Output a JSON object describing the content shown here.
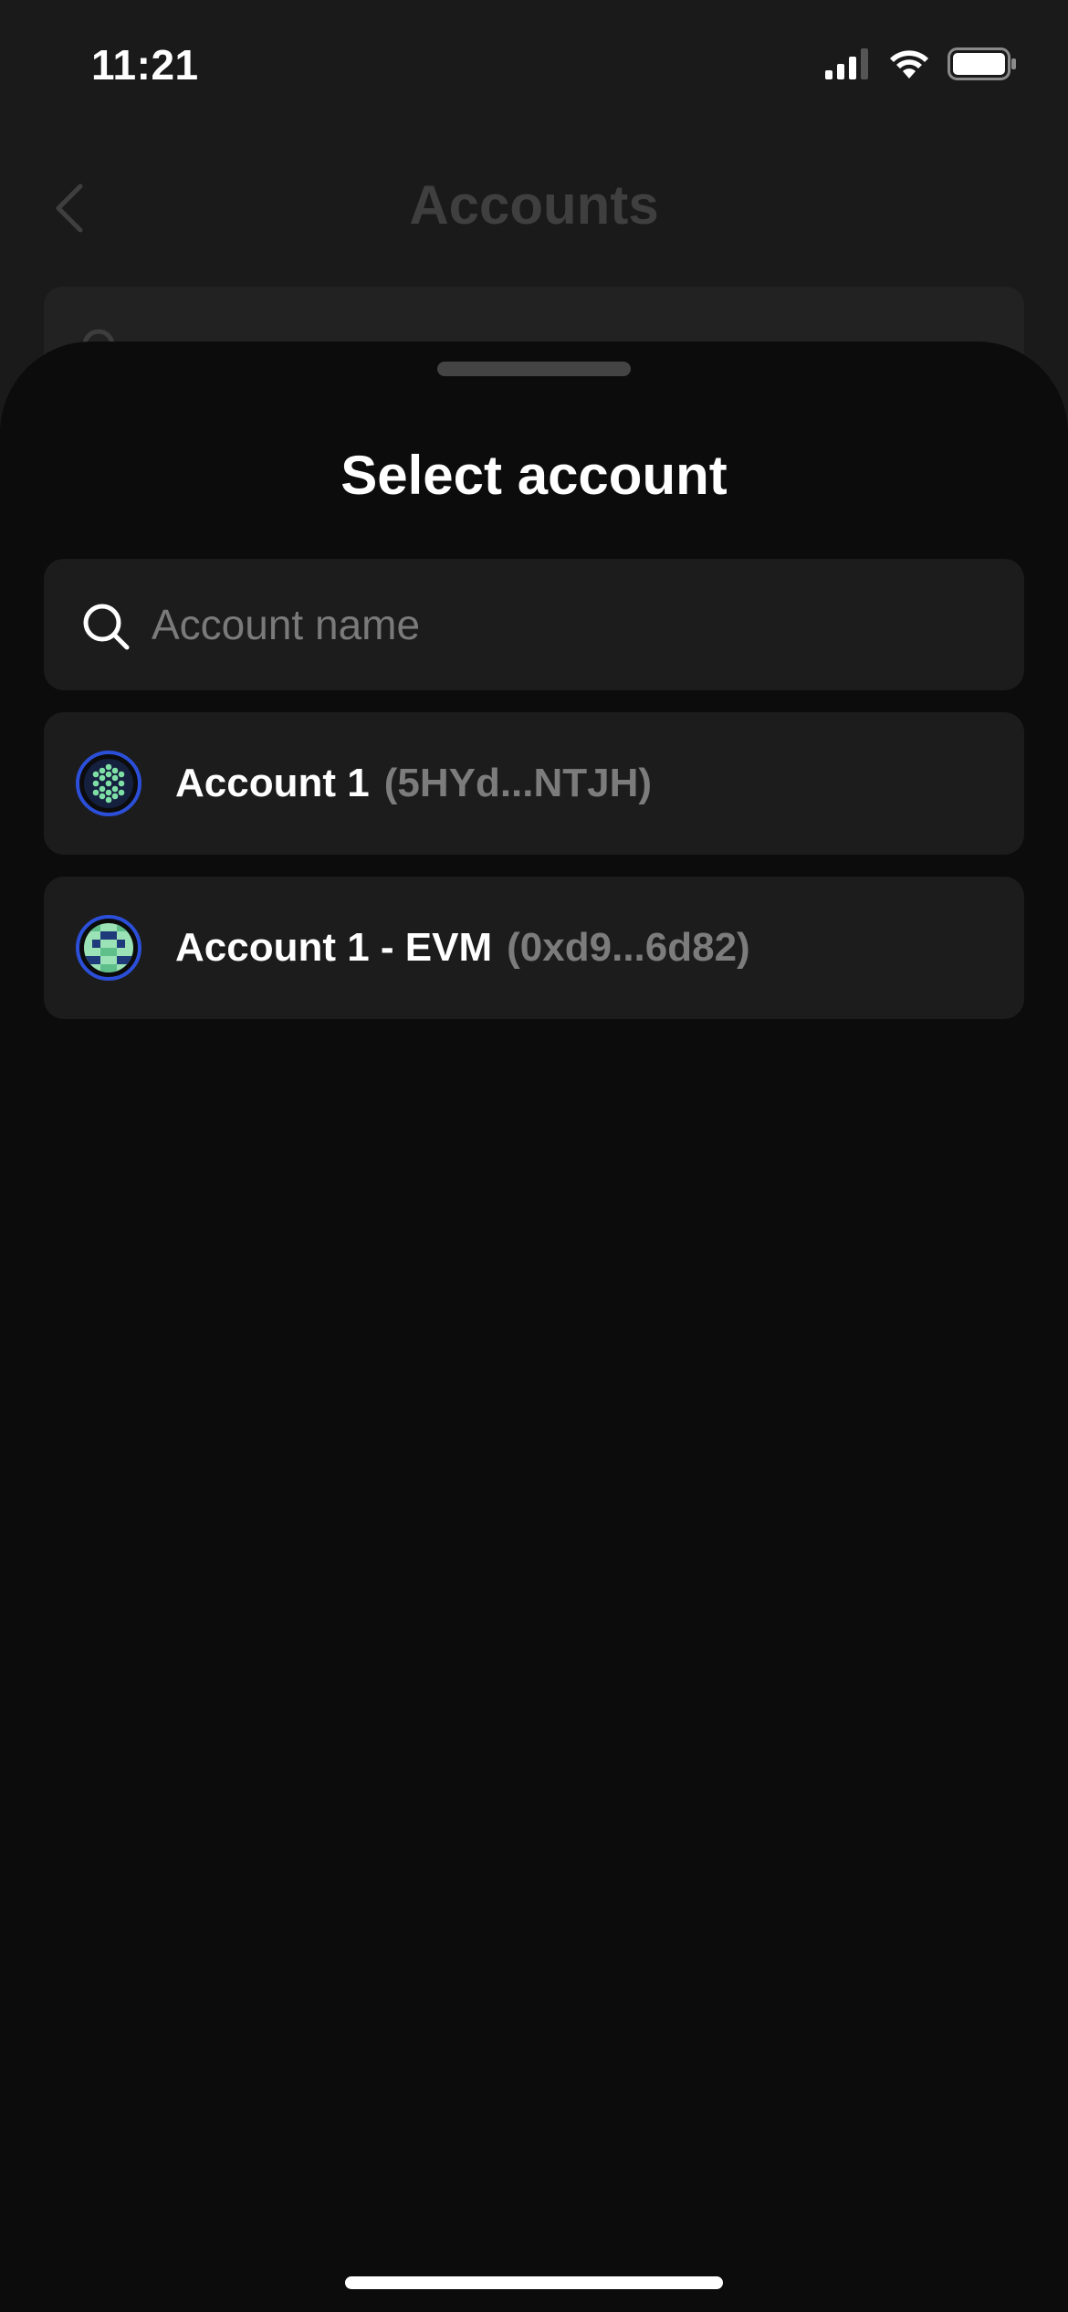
{
  "status_bar": {
    "time": "11:21",
    "icons": [
      "cellular-signal-icon",
      "wifi-icon",
      "battery-icon"
    ]
  },
  "background_page": {
    "title": "Accounts",
    "back_icon": "chevron-left-icon",
    "search_icon": "search-icon"
  },
  "sheet": {
    "title": "Select account",
    "search": {
      "placeholder": "Account name",
      "value": ""
    },
    "accounts": [
      {
        "name": "Account 1",
        "address": "(5HYd...NTJH)",
        "avatar_icon": "polkadot-identicon"
      },
      {
        "name": "Account 1 - EVM",
        "address": "(0xd9...6d82)",
        "avatar_icon": "evm-blockie-identicon"
      }
    ]
  },
  "colors": {
    "sheet_background": "#0c0c0c",
    "row_background": "#1c1c1c",
    "avatar_ring": "#2b4fd8",
    "identicon_green": "#7fe0a6",
    "muted_text": "#7c7c7c"
  }
}
